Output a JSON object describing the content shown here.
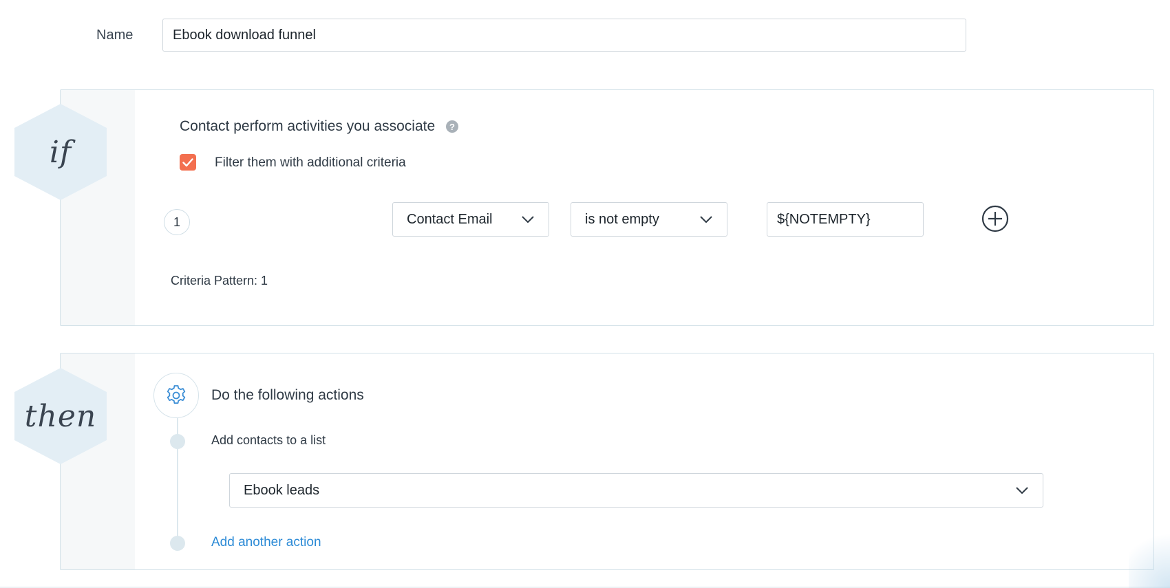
{
  "form": {
    "name_label": "Name",
    "name_value": "Ebook download funnel"
  },
  "if_section": {
    "hex_label": "if",
    "title": "Contact perform activities you associate",
    "help_icon": "question-circle-icon",
    "filter_checkbox_checked": true,
    "filter_label": "Filter them with additional criteria",
    "criteria": [
      {
        "number": "1",
        "field": "Contact Email",
        "operator": "is not empty",
        "value": "${NOTEMPTY}"
      }
    ],
    "criteria_pattern": "Criteria Pattern: 1",
    "add_icon": "plus-circle-icon"
  },
  "then_section": {
    "hex_label": "then",
    "icon": "gear-icon",
    "title": "Do the following actions",
    "actions": [
      {
        "label": "Add contacts to a list",
        "selected_list": "Ebook leads"
      }
    ],
    "add_action_label": "Add another action"
  },
  "colors": {
    "accent_checkbox": "#f36f4f",
    "link": "#2b8ad6",
    "hex_fill": "#e3eef5",
    "border": "#cfd6dc"
  }
}
